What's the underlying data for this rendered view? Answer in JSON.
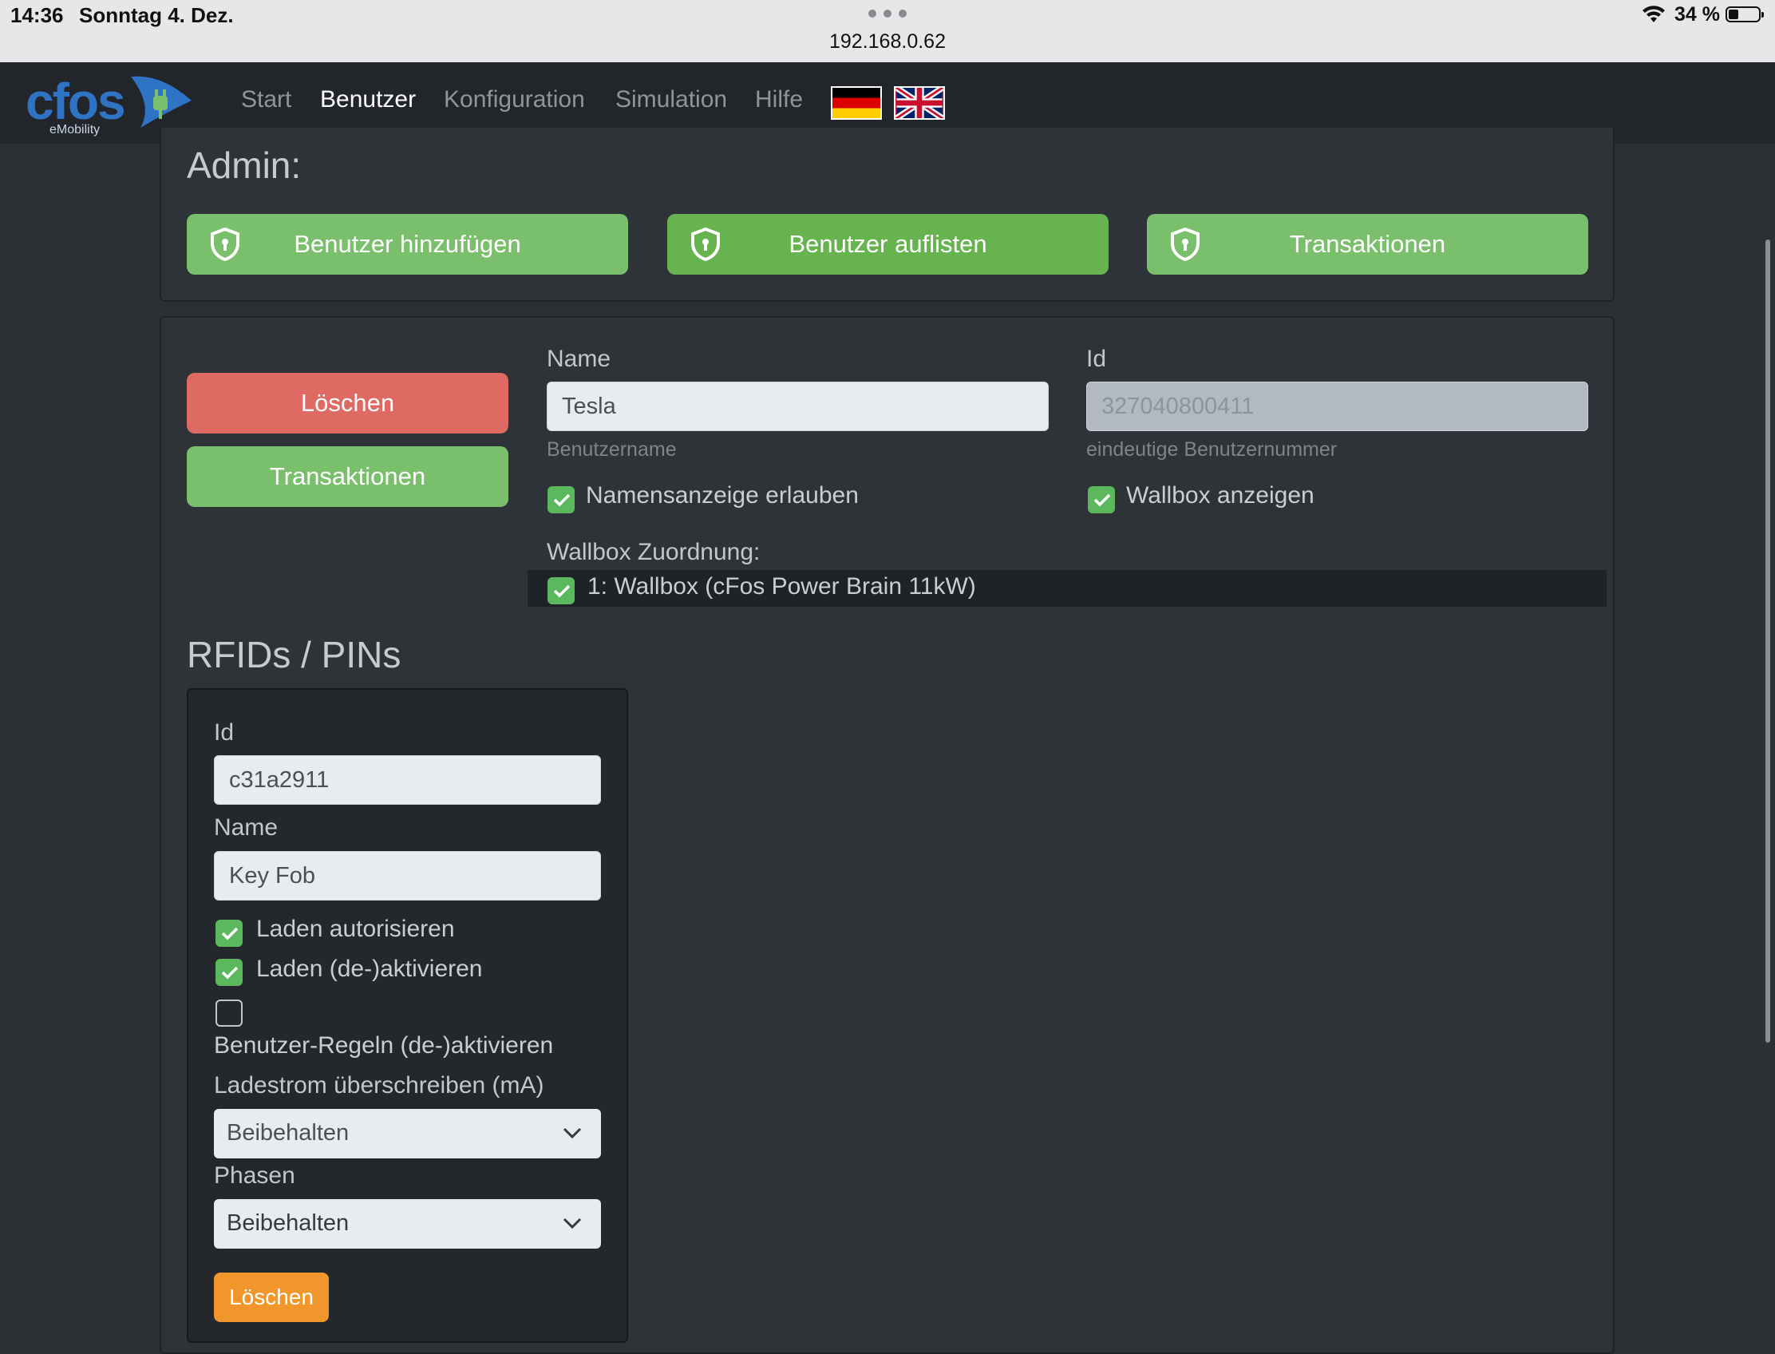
{
  "statusbar": {
    "time": "14:36",
    "date": "Sonntag 4. Dez.",
    "url": "192.168.0.62",
    "battery": "34 %"
  },
  "nav": {
    "logo": "cfos",
    "logo_sub": "eMobility",
    "links": [
      "Start",
      "Benutzer",
      "Konfiguration",
      "Simulation",
      "Hilfe"
    ],
    "active": "Benutzer"
  },
  "admin": {
    "heading": "Admin:",
    "buttons": [
      "Benutzer hinzufügen",
      "Benutzer auflisten",
      "Transaktionen"
    ]
  },
  "user": {
    "delete_label": "Löschen",
    "transactions_label": "Transaktionen",
    "name_label": "Name",
    "name_value": "Tesla",
    "name_hint": "Benutzername",
    "id_label": "Id",
    "id_value": "327040800411",
    "id_hint": "eindeutige Benutzernummer",
    "allow_name_display": "Namensanzeige erlauben",
    "allow_name_display_checked": true,
    "show_wallbox": "Wallbox anzeigen",
    "show_wallbox_checked": true,
    "wallbox_assignment_label": "Wallbox Zuordnung:",
    "wallbox_item": "1: Wallbox (cFos Power Brain 11kW)",
    "wallbox_item_checked": true
  },
  "rfids": {
    "heading": "RFIDs / PINs",
    "id_label": "Id",
    "id_value": "c31a2911",
    "name_label": "Name",
    "name_value": "Key Fob",
    "authorize_label": "Laden autorisieren",
    "authorize_checked": true,
    "toggle_charging_label": "Laden (de-)aktivieren",
    "toggle_charging_checked": true,
    "user_rules_label": "Benutzer-Regeln (de-)aktivieren",
    "user_rules_checked": false,
    "current_override_label": "Ladestrom überschreiben (mA)",
    "current_override_value": "Beibehalten",
    "phases_label": "Phasen",
    "phases_value": "Beibehalten",
    "delete_label": "Löschen"
  },
  "colors": {
    "green": "#7abf6b",
    "red": "#df6a63",
    "orange": "#f0962a",
    "brand_blue": "#2f73c4"
  }
}
